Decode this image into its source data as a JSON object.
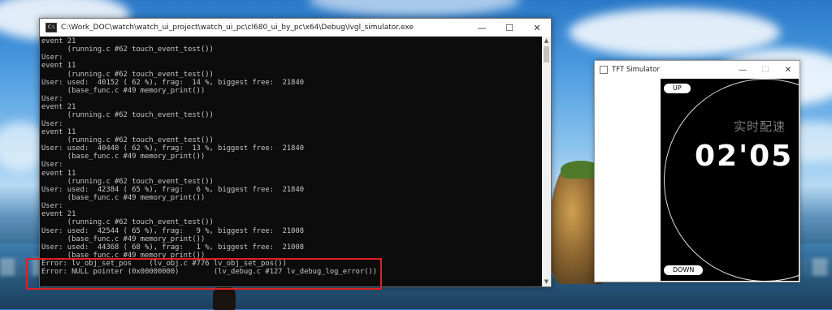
{
  "console": {
    "title": "C:\\Work_DOC\\watch\\watch_ui_project\\watch_ui_pc\\cl680_ui_by_pc\\x64\\Debug\\lvgl_simulator.exe",
    "icon": "console-app-icon",
    "controls": {
      "minimize": "—",
      "maximize": "☐",
      "close": "✕"
    },
    "lines": [
      "event 21",
      "      (running.c #62 touch_event_test())",
      "User:",
      "event 11",
      "      (running.c #62 touch_event_test())",
      "User: used:  40152 ( 62 %), frag:  14 %, biggest free:  21840",
      "      (base_func.c #49 memory_print())",
      "User:",
      "event 21",
      "      (running.c #62 touch_event_test())",
      "User:",
      "event 11",
      "      (running.c #62 touch_event_test())",
      "User: used:  40440 ( 62 %), frag:  13 %, biggest free:  21840",
      "      (base_func.c #49 memory_print())",
      "User:",
      "event 11",
      "      (running.c #62 touch_event_test())",
      "User: used:  42384 ( 65 %), frag:   6 %, biggest free:  21840",
      "      (base_func.c #49 memory_print())",
      "User:",
      "event 21",
      "      (running.c #62 touch_event_test())",
      "User: used:  42544 ( 65 %), frag:   9 %, biggest free:  21008",
      "      (base_func.c #49 memory_print())",
      "User: used:  44368 ( 68 %), frag:   1 %, biggest free:  21008",
      "      (base_func.c #49 memory_print())",
      "Error: lv_obj_set_pos    (lv_obj.c #776 lv_obj_set_pos())",
      "Error: NULL pointer (0x00000000)        (lv_debug.c #127 lv_debug_log_error())"
    ]
  },
  "simulator": {
    "title": "TFT Simulator",
    "controls": {
      "minimize": "—",
      "maximize": "☐",
      "close": "✕"
    },
    "up_label": "UP",
    "down_label": "DOWN",
    "pace_label": "实时配速",
    "pace_value": "02'05"
  },
  "colors": {
    "console_bg": "#0c0c0c",
    "console_text": "#c8c8c8",
    "error_highlight": "#e02020",
    "watch_bg": "#000000"
  }
}
